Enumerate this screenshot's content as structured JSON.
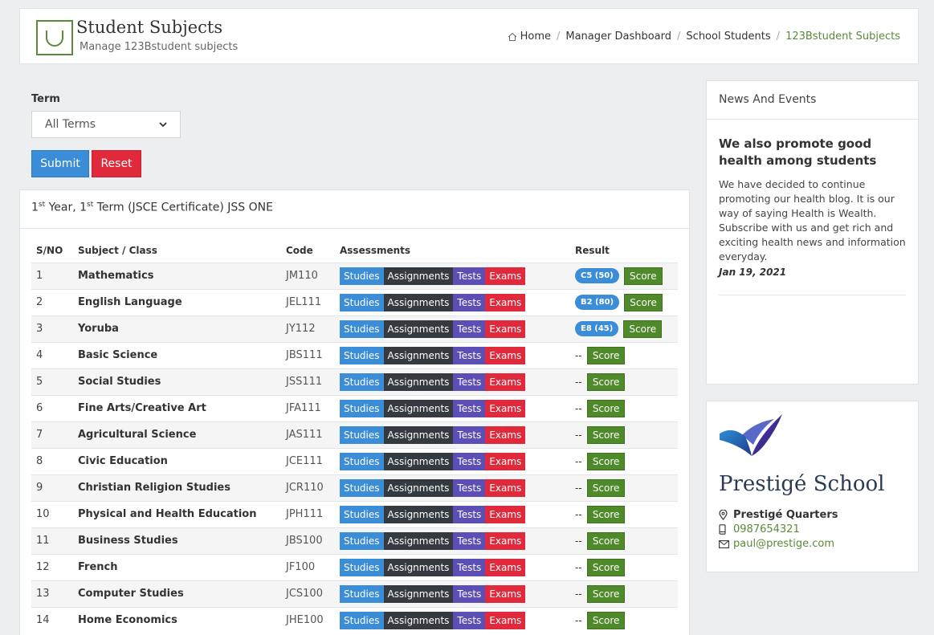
{
  "header": {
    "title": "Student Subjects",
    "subtitle": "Manage 123Bstudent subjects",
    "breadcrumb": [
      "Home",
      "Manager Dashboard",
      "School Students",
      "123Bstudent Subjects"
    ]
  },
  "filter": {
    "term_label": "Term",
    "term_selected": "All Terms",
    "submit_label": "Submit",
    "reset_label": "Reset"
  },
  "table_card": {
    "title_year": "1",
    "title_year_sup": "st",
    "title_mid": " Year, 1",
    "title_term_sup": "st",
    "title_rest": " Term (JSCE Certificate) JSS ONE",
    "columns": [
      "S/NO",
      "Subject / Class",
      "Code",
      "Assessments",
      "Result"
    ],
    "assessment_labels": [
      "Studies",
      "Assignments",
      "Tests",
      "Exams"
    ],
    "score_label": "Score",
    "rows": [
      {
        "sn": "1",
        "subject": "Mathematics",
        "code": "JM110",
        "grade": "C5 (50)"
      },
      {
        "sn": "2",
        "subject": "English Language",
        "code": "JEL111",
        "grade": "B2 (80)"
      },
      {
        "sn": "3",
        "subject": "Yoruba",
        "code": "JY112",
        "grade": "E8 (45)"
      },
      {
        "sn": "4",
        "subject": "Basic Science",
        "code": "JBS111",
        "grade": "--"
      },
      {
        "sn": "5",
        "subject": "Social Studies",
        "code": "JSS111",
        "grade": "--"
      },
      {
        "sn": "6",
        "subject": "Fine Arts/Creative Art",
        "code": "JFA111",
        "grade": "--"
      },
      {
        "sn": "7",
        "subject": "Agricultural Science",
        "code": "JAS111",
        "grade": "--"
      },
      {
        "sn": "8",
        "subject": "Civic Education",
        "code": "JCE111",
        "grade": "--"
      },
      {
        "sn": "9",
        "subject": "Christian Religion Studies",
        "code": "JCR110",
        "grade": "--"
      },
      {
        "sn": "10",
        "subject": "Physical and Health Education",
        "code": "JPH111",
        "grade": "--"
      },
      {
        "sn": "11",
        "subject": "Business Studies",
        "code": "JBS100",
        "grade": "--"
      },
      {
        "sn": "12",
        "subject": "French",
        "code": "JF100",
        "grade": "--"
      },
      {
        "sn": "13",
        "subject": "Computer Studies",
        "code": "JCS100",
        "grade": "--"
      },
      {
        "sn": "14",
        "subject": "Home Economics",
        "code": "JHE100",
        "grade": "--"
      }
    ]
  },
  "news": {
    "header": "News And Events",
    "title": "We also promote good health among students",
    "body": "We have decided to continue promoting our health blog. It is our way of saying Health is Wealth. Subscribe with us and get rich and exciting health news and information everyday.",
    "date": "Jan 19, 2021"
  },
  "school": {
    "name": "Prestigé School",
    "address": "Prestigé Quarters",
    "phone": "0987654321",
    "email": "paul@prestige.com"
  },
  "colors": {
    "accent_green": "#5b8a3a",
    "primary_blue": "#3a8dd6",
    "danger_red": "#e02a3c",
    "dark": "#343a40",
    "tests_purple": "#5b4fb5"
  }
}
